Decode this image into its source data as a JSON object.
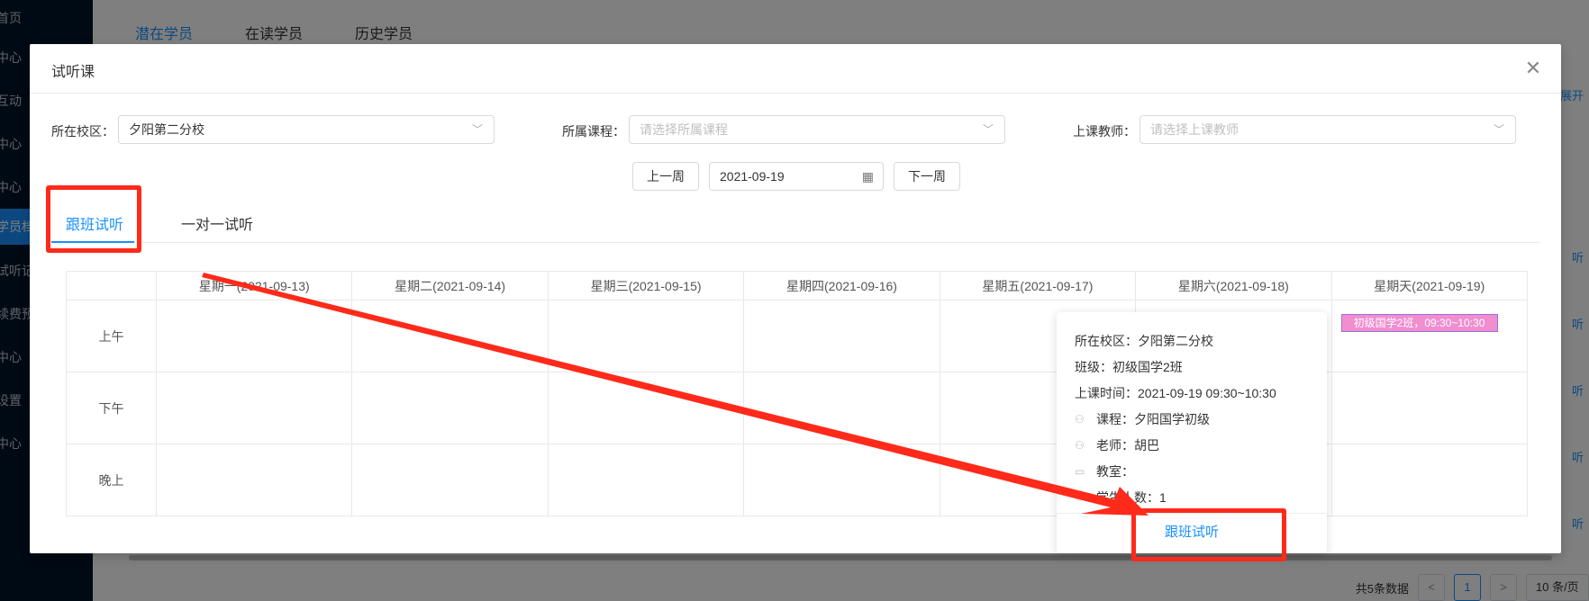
{
  "sidebar": {
    "items": [
      {
        "label": "首页",
        "active": false
      },
      {
        "label": "中心",
        "active": false
      },
      {
        "label": "互动",
        "active": false
      },
      {
        "label": "中心",
        "active": false
      },
      {
        "label": "中心",
        "active": false
      },
      {
        "label": "学员档",
        "active": true
      },
      {
        "label": "试听记",
        "active": false
      },
      {
        "label": "续费预",
        "active": false
      },
      {
        "label": "中心",
        "active": false
      },
      {
        "label": "设置",
        "active": false
      },
      {
        "label": "中心",
        "active": false
      }
    ]
  },
  "background": {
    "tabs": [
      "潜在学员",
      "在读学员",
      "历史学员"
    ],
    "expand_link": "展开",
    "row_links": [
      "听",
      "听",
      "听",
      "听",
      "听"
    ],
    "pager": {
      "total": "共5条数据",
      "prev": "<",
      "current_page": "1",
      "next": ">",
      "page_size": "10 条/页"
    }
  },
  "modal": {
    "title": "试听课",
    "close_icon": "close-icon",
    "filters": {
      "campus_label": "所在校区：",
      "campus_value": "夕阳第二分校",
      "course_label": "所属课程：",
      "course_placeholder": "请选择所属课程",
      "teacher_label": "上课教师：",
      "teacher_placeholder": "请选择上课教师"
    },
    "week_nav": {
      "prev_label": "上一周",
      "date_value": "2021-09-19",
      "next_label": "下一周"
    },
    "tabs": [
      {
        "label": "跟班试听",
        "active": true
      },
      {
        "label": "一对一试听",
        "active": false
      }
    ],
    "calendar": {
      "columns": [
        "星期一(2021-09-13)",
        "星期二(2021-09-14)",
        "星期三(2021-09-15)",
        "星期四(2021-09-16)",
        "星期五(2021-09-17)",
        "星期六(2021-09-18)",
        "星期天(2021-09-19)"
      ],
      "rows": [
        "上午",
        "下午",
        "晚上"
      ],
      "lesson": {
        "label": "初级国学2班，09:30~10:30",
        "day_index": 6,
        "row_index": 0,
        "color": "#f08ed0"
      }
    },
    "popover": {
      "campus": "所在校区：夕阳第二分校",
      "class": "班级：初级国学2班",
      "time": "上课时间：2021-09-19 09:30~10:30",
      "course": "课程：夕阳国学初级",
      "teacher": "老师：胡巴",
      "room": "教室：",
      "students": "学生人数：1",
      "action": "跟班试听"
    }
  },
  "colors": {
    "accent": "#1890ff",
    "annotation": "#ff2a1a",
    "sidebar_bg": "#001529"
  }
}
